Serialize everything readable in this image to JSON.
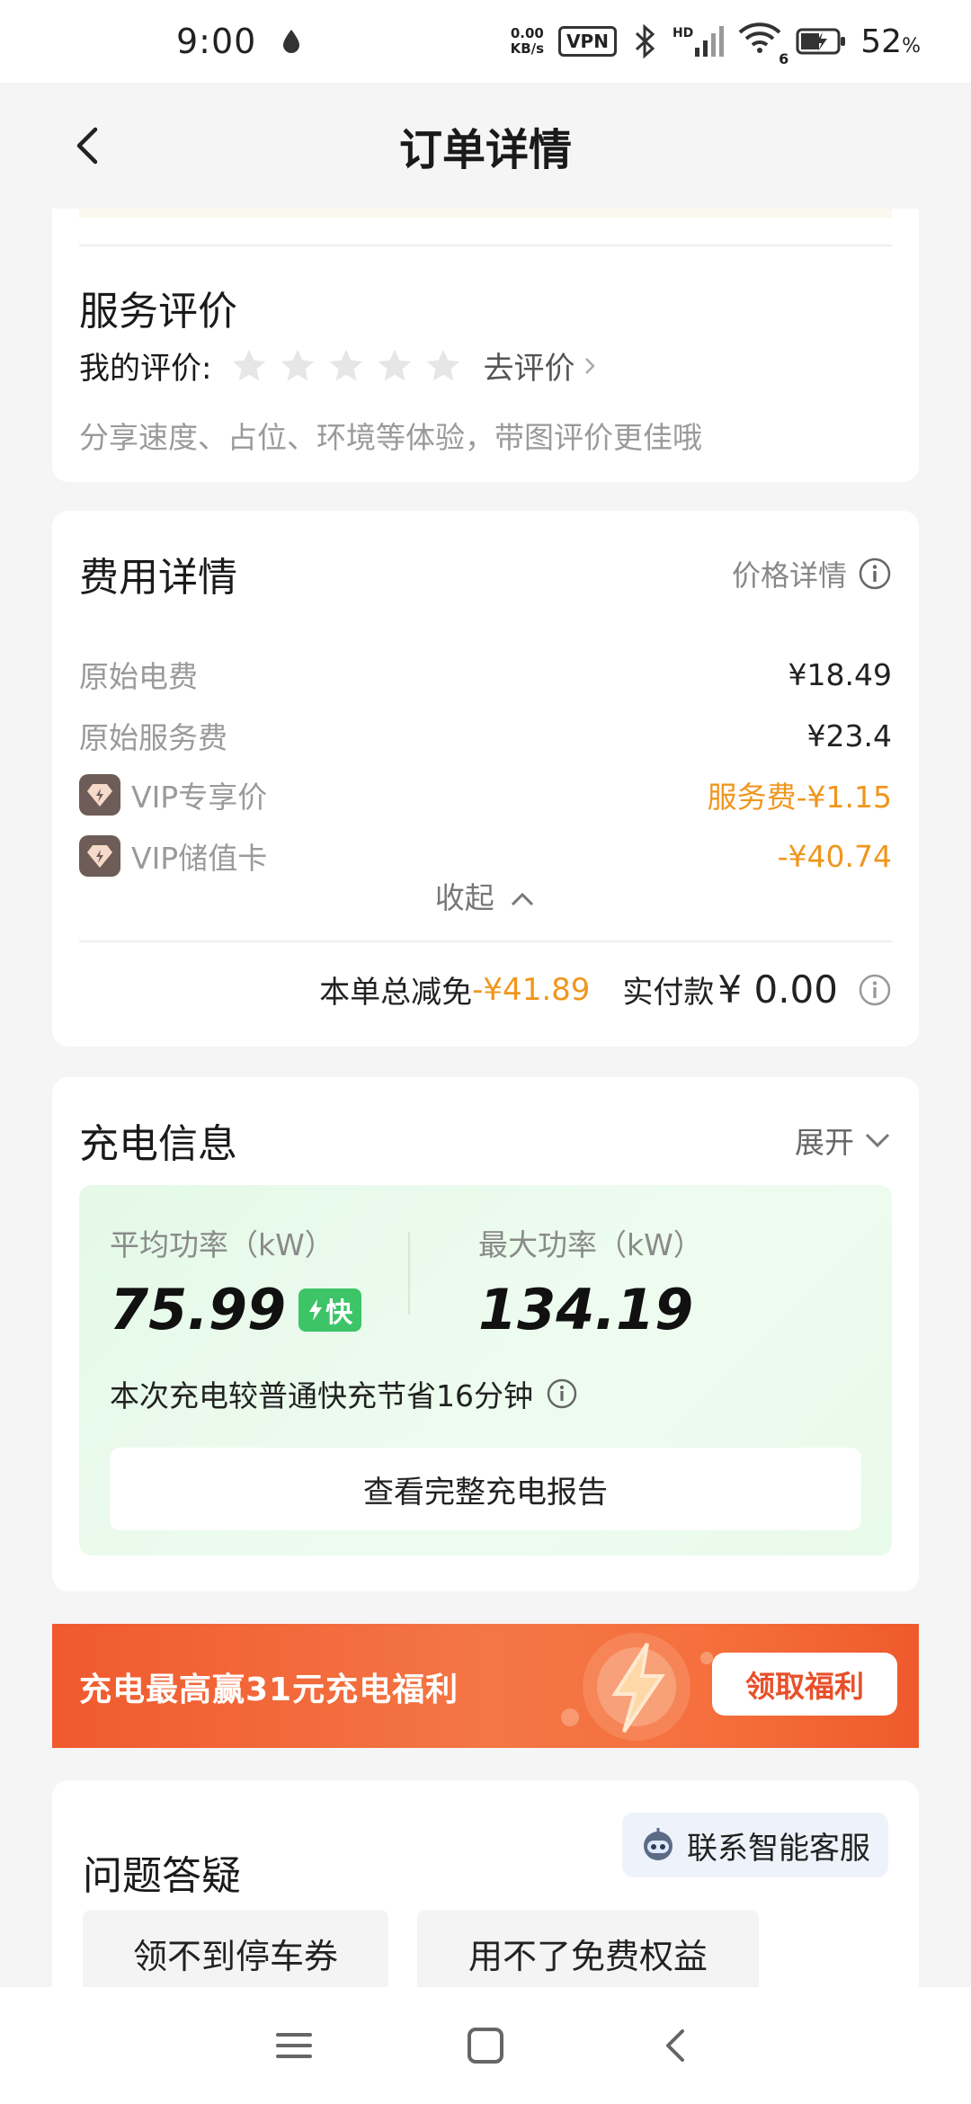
{
  "status_bar": {
    "time": "9:00",
    "net_speed_value": "0.00",
    "net_speed_unit": "KB/s",
    "vpn": "VPN",
    "hd": "HD",
    "wifi_gen": "6",
    "battery_percent": "52",
    "percent_sign": "%"
  },
  "header": {
    "title": "订单详情"
  },
  "rating": {
    "title": "服务评价",
    "my_rating_label": "我的评价:",
    "stars_total": 5,
    "stars_filled": 0,
    "go_rate": "去评价",
    "hint": "分享速度、占位、环境等体验，带图评价更佳哦"
  },
  "fees": {
    "title": "费用详情",
    "price_detail": "价格详情",
    "rows": [
      {
        "label": "原始电费",
        "value": "¥18.49"
      },
      {
        "label": "原始服务费",
        "value": "¥23.4"
      },
      {
        "label": "VIP专享价",
        "value": "服务费-¥1.15"
      },
      {
        "label": "VIP储值卡",
        "value": "-¥40.74"
      }
    ],
    "collapse": "收起",
    "total_discount_label": "本单总减免",
    "total_discount_value": "-¥41.89",
    "paid_label": "实付款",
    "paid_value": "¥ 0.00"
  },
  "charging": {
    "title": "充电信息",
    "expand": "展开",
    "avg_power_label": "平均功率（kW）",
    "avg_power_value": "75.99",
    "fast_badge": "快",
    "max_power_label": "最大功率（kW）",
    "max_power_value": "134.19",
    "saving_text": "本次充电较普通快充节省16分钟",
    "report_button": "查看完整充电报告"
  },
  "banner": {
    "text": "充电最高赢31元充电福利",
    "button": "领取福利"
  },
  "qa": {
    "title": "问题答疑",
    "cs_button": "联系智能客服",
    "chips": [
      "领不到停车券",
      "用不了免费权益"
    ]
  },
  "colors": {
    "accent_orange": "#f0961e",
    "fast_green": "#3cc467",
    "banner_red": "#f05a2e"
  }
}
